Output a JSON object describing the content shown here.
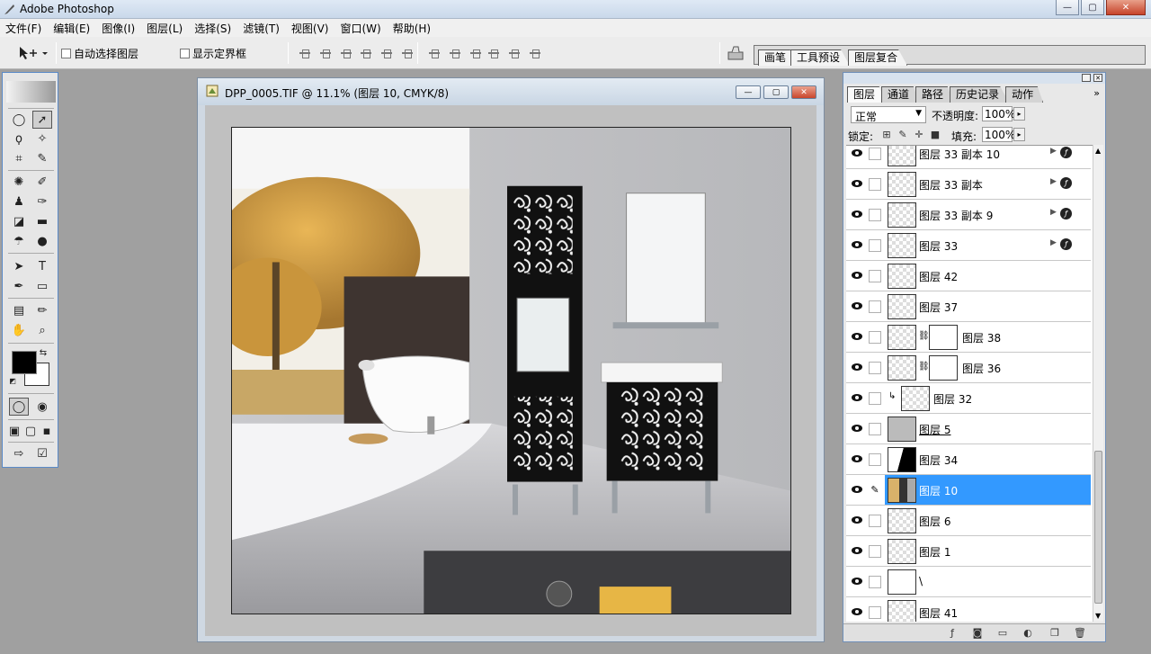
{
  "app": {
    "title": "Adobe Photoshop"
  },
  "window_controls": {
    "minimize": "—",
    "maximize": "▢",
    "close": "✕"
  },
  "menu": [
    "文件(F)",
    "编辑(E)",
    "图像(I)",
    "图层(L)",
    "选择(S)",
    "滤镜(T)",
    "视图(V)",
    "窗口(W)",
    "帮助(H)"
  ],
  "options": {
    "auto_select_label": "自动选择图层",
    "show_bounds_label": "显示定界框",
    "well_tabs": [
      "画笔",
      "工具预设",
      "图层复合"
    ]
  },
  "document": {
    "title": "DPP_0005.TIF @ 11.1% (图层 10, CMYK/8)"
  },
  "layers_panel": {
    "tabs": [
      "图层",
      "通道",
      "路径",
      "历史记录",
      "动作"
    ],
    "blend_mode": "正常",
    "opacity_label": "不透明度:",
    "opacity_value": "100%",
    "lock_label": "锁定:",
    "fill_label": "填充:",
    "fill_value": "100%",
    "layers": [
      {
        "name": "图层 33 副本 10",
        "fx": true
      },
      {
        "name": "图层 33 副本",
        "fx": true
      },
      {
        "name": "图层 33 副本 9",
        "fx": true
      },
      {
        "name": "图层 33",
        "fx": true
      },
      {
        "name": "图层 42"
      },
      {
        "name": "图层 37"
      },
      {
        "name": "图层 38",
        "mask": true
      },
      {
        "name": "图层 36",
        "mask": true
      },
      {
        "name": "图层 32",
        "clipped": true
      },
      {
        "name": "图层 5"
      },
      {
        "name": "图层 34"
      },
      {
        "name": "图层 10",
        "selected": true
      },
      {
        "name": "图层 6"
      },
      {
        "name": "图层 1"
      },
      {
        "name": "\\"
      },
      {
        "name": "图层 41"
      }
    ]
  }
}
